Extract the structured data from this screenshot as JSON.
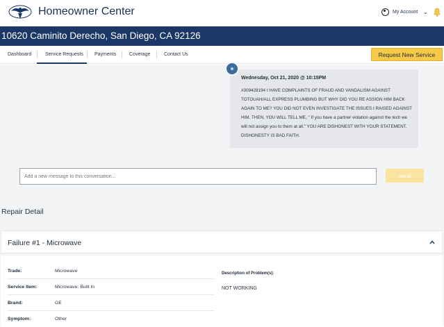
{
  "header": {
    "app_title": "Homeowner Center",
    "account_label": "My Account",
    "icons": [
      "eagle-logo-icon",
      "user-icon",
      "chevron-down-icon",
      "bell-icon"
    ]
  },
  "address": "10620 Caminito Derecho, San Diego, CA 92126",
  "nav": {
    "items": [
      {
        "label": "Dashboard",
        "active": false
      },
      {
        "label": "Service Requests",
        "active": true
      },
      {
        "label": "Payments",
        "active": false
      },
      {
        "label": "Coverage",
        "active": false
      },
      {
        "label": "Contact Us",
        "active": false
      }
    ],
    "cta_label": "Request New Service"
  },
  "conversation": {
    "message": {
      "date": "Wednesday, Oct 21, 2020 @ 10:15PM",
      "text": "#309428194 I HAVE COMPLAINTS OF FRAUD AND VANDALISM AGAINST TOTOUAH/ALL EXPRESS PLUMBING BUT WHY DID YOU RE ASSIGN HIM BACK AGAIN TO ME? YOU DID NOT EVEN INVESTIGATE THE ISSUES I RAISED AGAINST HIM. THEN, YOU WILL TELL ME, \" If you have a partner violation against the tech we will not assign you to them at all.\" YOU ARE DISHONEST WITH YOUR STATEMENT. DISHONESTY IS BAD FAITH."
    },
    "compose_placeholder": "Add a new message to this conversation...",
    "send_label": "Send"
  },
  "repair": {
    "section_title": "Repair Detail",
    "failure_title": "Failure #1 - Microwave",
    "fields": [
      {
        "label": "Trade:",
        "value": "Microwave"
      },
      {
        "label": "Service Item:",
        "value": "Microwave: Built In"
      },
      {
        "label": "Brand:",
        "value": "GE"
      },
      {
        "label": "Symptom:",
        "value": "Other"
      }
    ],
    "description_label": "Description of Problem(s):",
    "description_value": "NOT WORKING"
  },
  "colors": {
    "primary_navy": "#1b3766",
    "accent_yellow": "#f7c948",
    "send_disabled": "#fbe3a0",
    "panel_bg": "#f3f4f6"
  }
}
